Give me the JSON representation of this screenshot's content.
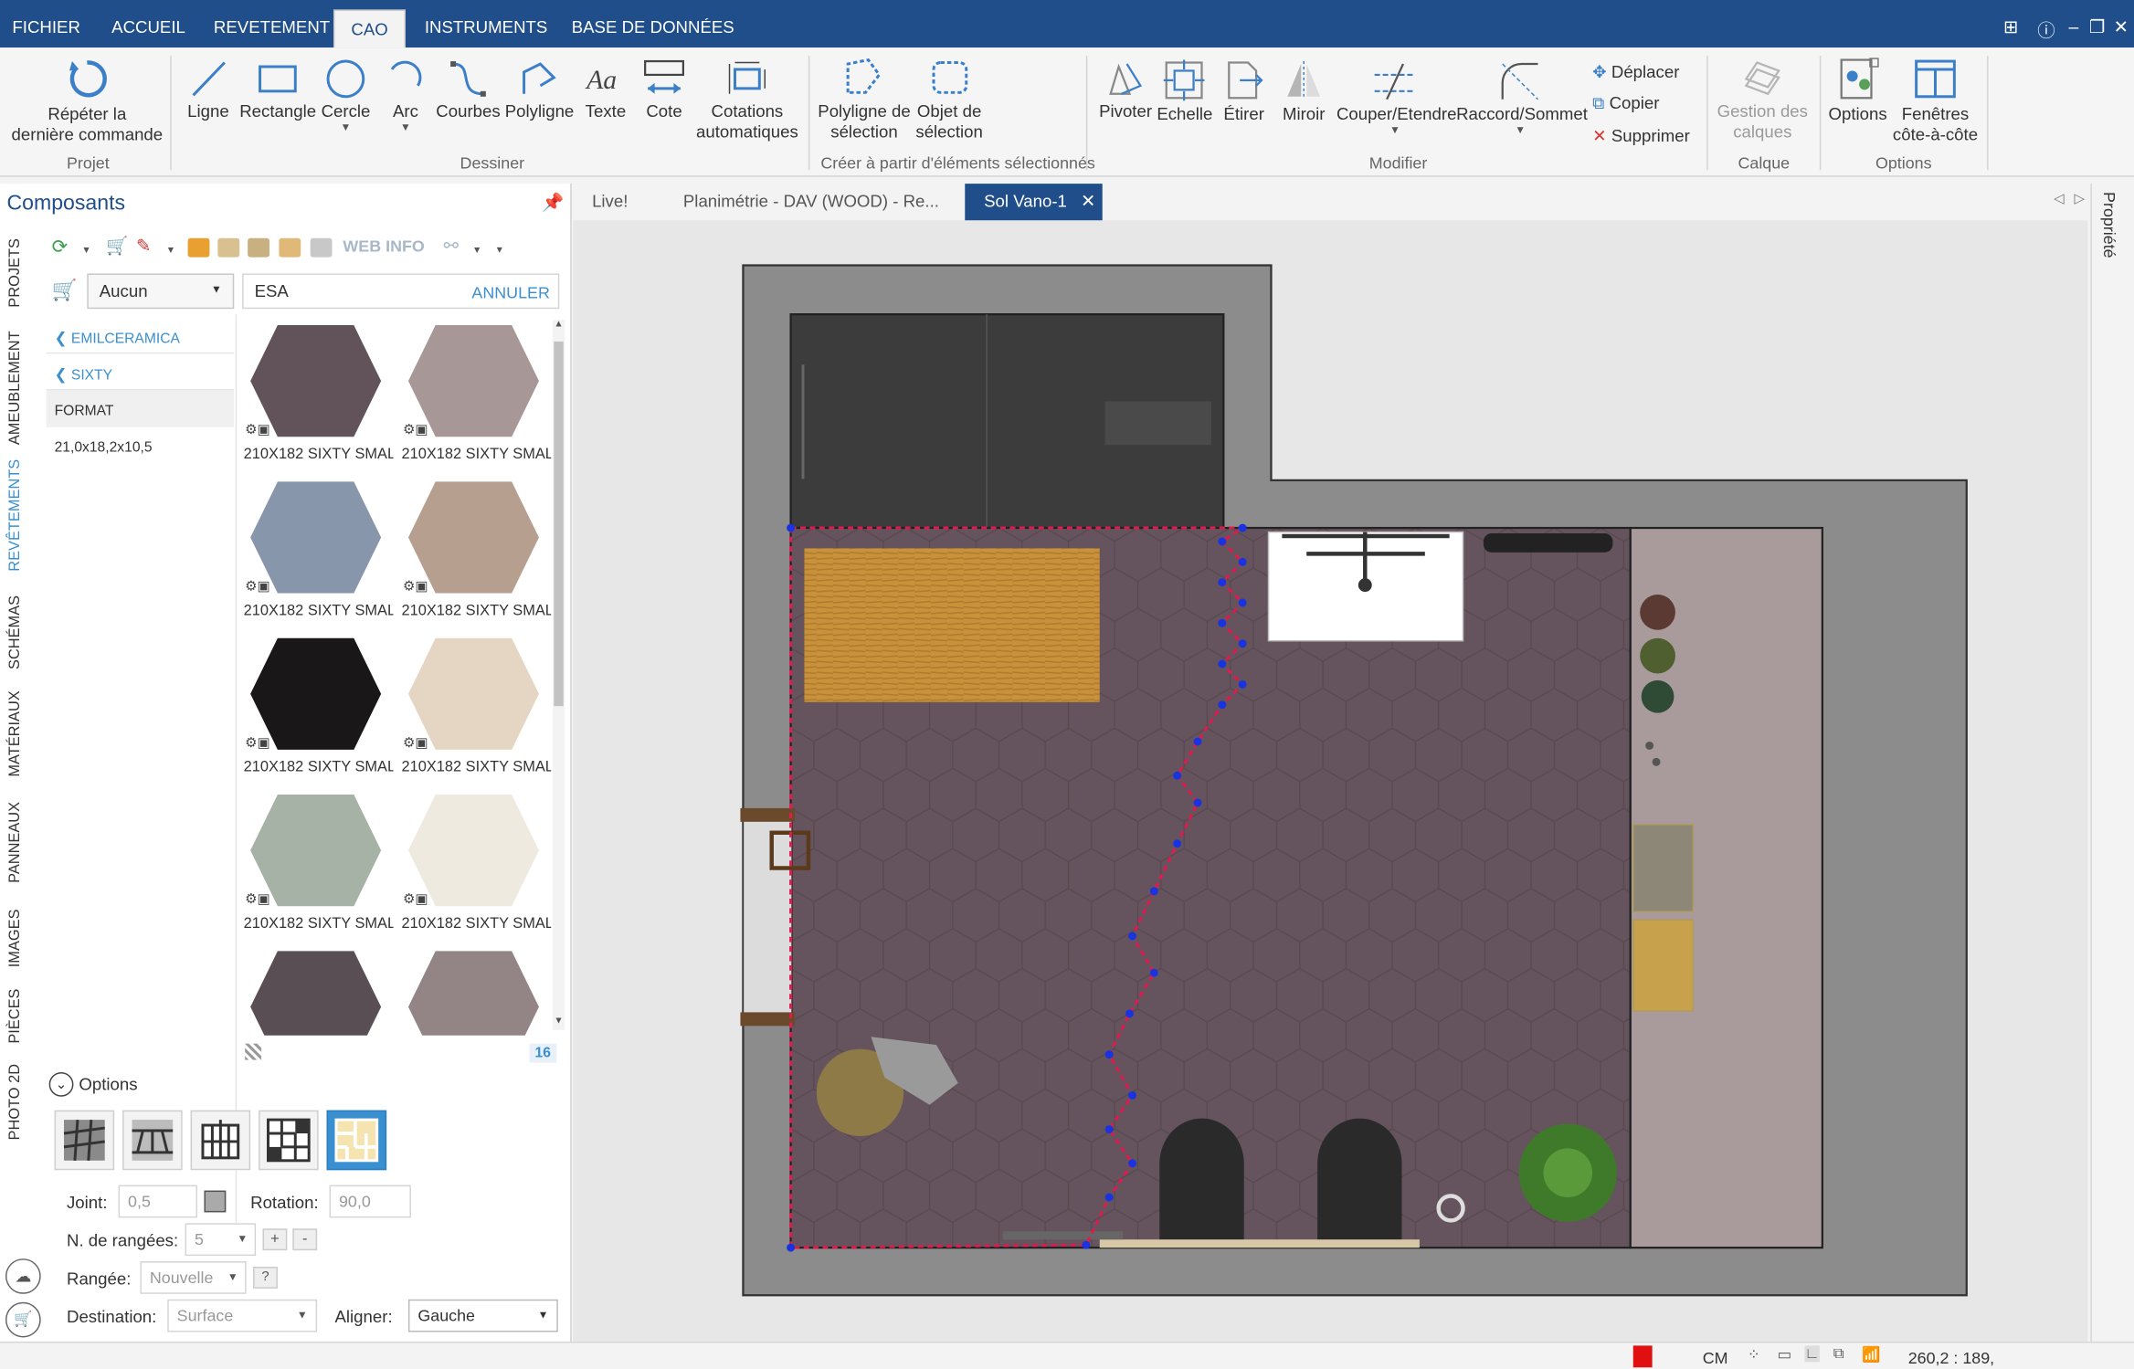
{
  "menu": {
    "items": [
      "FICHIER",
      "ACCUEIL",
      "REVETEMENT",
      "CAO",
      "INSTRUMENTS",
      "BASE DE DONNÉES"
    ],
    "active": "CAO"
  },
  "ribbon": {
    "repeat": {
      "l1": "Répéter la",
      "l2": "dernière commande"
    },
    "group_projet": "Projet",
    "ligne": "Ligne",
    "rectangle": "Rectangle",
    "cercle": "Cercle",
    "arc": "Arc",
    "courbes": "Courbes",
    "polyligne": "Polyligne",
    "texte": "Texte",
    "cote": "Cote",
    "cotations": {
      "l1": "Cotations",
      "l2": "automatiques"
    },
    "group_dessiner": "Dessiner",
    "polyligne_sel": {
      "l1": "Polyligne de",
      "l2": "sélection"
    },
    "objet_sel": {
      "l1": "Objet de",
      "l2": "sélection"
    },
    "group_creer": "Créer à partir d'éléments sélectionnés",
    "pivoter": "Pivoter",
    "echelle": "Echelle",
    "etirer": "Étirer",
    "miroir": "Miroir",
    "couper": "Couper/Etendre",
    "raccord": "Raccord/Sommet",
    "deplacer": "Déplacer",
    "copier": "Copier",
    "supprimer": "Supprimer",
    "group_modifier": "Modifier",
    "gestion": {
      "l1": "Gestion des",
      "l2": "calques"
    },
    "group_calque": "Calque",
    "options": "Options",
    "fenetres": {
      "l1": "Fenêtres",
      "l2": "côte-à-côte"
    },
    "group_options": "Options"
  },
  "left_panel": {
    "title": "Composants",
    "vertical_tabs": [
      "PROJETS",
      "AMEUBLEMENT",
      "REVÊTEMENTS",
      "SCHÉMAS",
      "MATÉRIAUX",
      "PANNEAUX",
      "IMAGES",
      "PIÈCES",
      "PHOTO 2D"
    ],
    "active_tab": "REVÊTEMENTS",
    "toolbar_web": "WEB INFO",
    "filter_select": "Aucun",
    "search_value": "ESA",
    "search_cancel": "ANNULER",
    "breadcrumb": [
      "EMILCERAMICA",
      "SIXTY"
    ],
    "format_header": "FORMAT",
    "format_value": "21,0x18,2x10,5",
    "tiles": [
      {
        "label": "210X182 SIXTY SMALL",
        "color": "#625259"
      },
      {
        "label": "210X182 SIXTY SMALL",
        "color": "#a89797"
      },
      {
        "label": "210X182 SIXTY SMALL",
        "color": "#8896ab"
      },
      {
        "label": "210X182 SIXTY SMALL",
        "color": "#b69f8f"
      },
      {
        "label": "210X182 SIXTY SMALL",
        "color": "#1a1718"
      },
      {
        "label": "210X182 SIXTY SMALL",
        "color": "#e4d6c2"
      },
      {
        "label": "210X182 SIXTY SMALL",
        "color": "#a5b2a5"
      },
      {
        "label": "210X182 SIXTY SMALL",
        "color": "#efeae0"
      },
      {
        "label": "",
        "color": "#5a4e55"
      },
      {
        "label": "",
        "color": "#938485"
      }
    ],
    "result_count": "16",
    "options_label": "Options",
    "joint_label": "Joint:",
    "joint_value": "0,5",
    "rotation_label": "Rotation:",
    "rotation_value": "90,0",
    "rangees_label": "N. de rangées:",
    "rangees_value": "5",
    "plus": "+",
    "minus": "-",
    "rangee_label": "Rangée:",
    "rangee_value": "Nouvelle",
    "rangee_help": "?",
    "destination_label": "Destination:",
    "destination_value": "Surface",
    "aligner_label": "Aligner:",
    "aligner_value": "Gauche"
  },
  "tabs": [
    {
      "label": "Live!",
      "active": false
    },
    {
      "label": "Planimétrie - DAV (WOOD) - Re...",
      "active": false
    },
    {
      "label": "Sol Vano-1",
      "active": true
    }
  ],
  "props_label": "Propriété",
  "status": {
    "unit": "CM",
    "coords": "260,2 : 189,"
  },
  "colors": {
    "brand": "#1f4e8a",
    "accent": "#3a8fd0",
    "floor": "#65545e",
    "wall": "#8c8c8c",
    "selection_red": "#e0194f",
    "selection_blue": "#1a33e0"
  }
}
